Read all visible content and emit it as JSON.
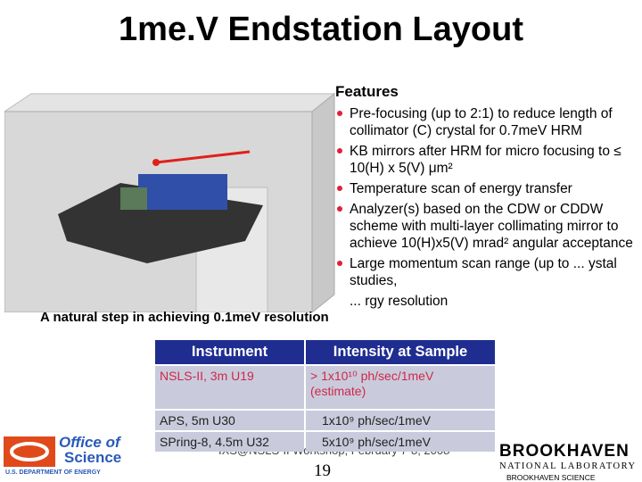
{
  "title": "1me.V Endstation Layout",
  "features": {
    "heading": "Features",
    "items": [
      "Pre-focusing (up to 2:1) to reduce length of collimator (C) crystal for 0.7meV HRM",
      "KB mirrors after HRM for micro focusing to ≤ 10(H) x 5(V) μm²",
      "Temperature scan of energy transfer",
      "Analyzer(s) based on the CDW or CDDW scheme with multi-layer collimating mirror to achieve 10(H)x5(V) mrad² angular acceptance",
      "Large momentum scan range (up to ... ystal studies,",
      "... rgy resolution"
    ]
  },
  "natural_step": "A natural step in achieving 0.1meV resolution",
  "table": {
    "headers": [
      "Instrument",
      "Intensity at Sample"
    ],
    "rows": [
      [
        "NSLS-II, 3m U19",
        "> 1x10¹⁰ ph/sec/1meV (estimate)"
      ],
      [
        "APS, 5m U30",
        "1x10⁹ ph/sec/1meV"
      ],
      [
        "SPring-8, 4.5m U32",
        "5x10⁹ ph/sec/1meV"
      ]
    ]
  },
  "footer": "IXS@NSLS-II Workshop, February 7-8, 2008",
  "page_number": "19",
  "logos": {
    "doe": [
      "Office of",
      "Science",
      "U.S. DEPARTMENT OF ENERGY"
    ],
    "bnl": [
      "BROOKHAVEN",
      "NATIONAL LABORATORY",
      "BROOKHAVEN SCIENCE"
    ]
  },
  "colors": {
    "table_header": "#1f2d91",
    "table_row": "#c9cbdc",
    "highlight": "#d0284a",
    "bullet": "#e0203a"
  }
}
